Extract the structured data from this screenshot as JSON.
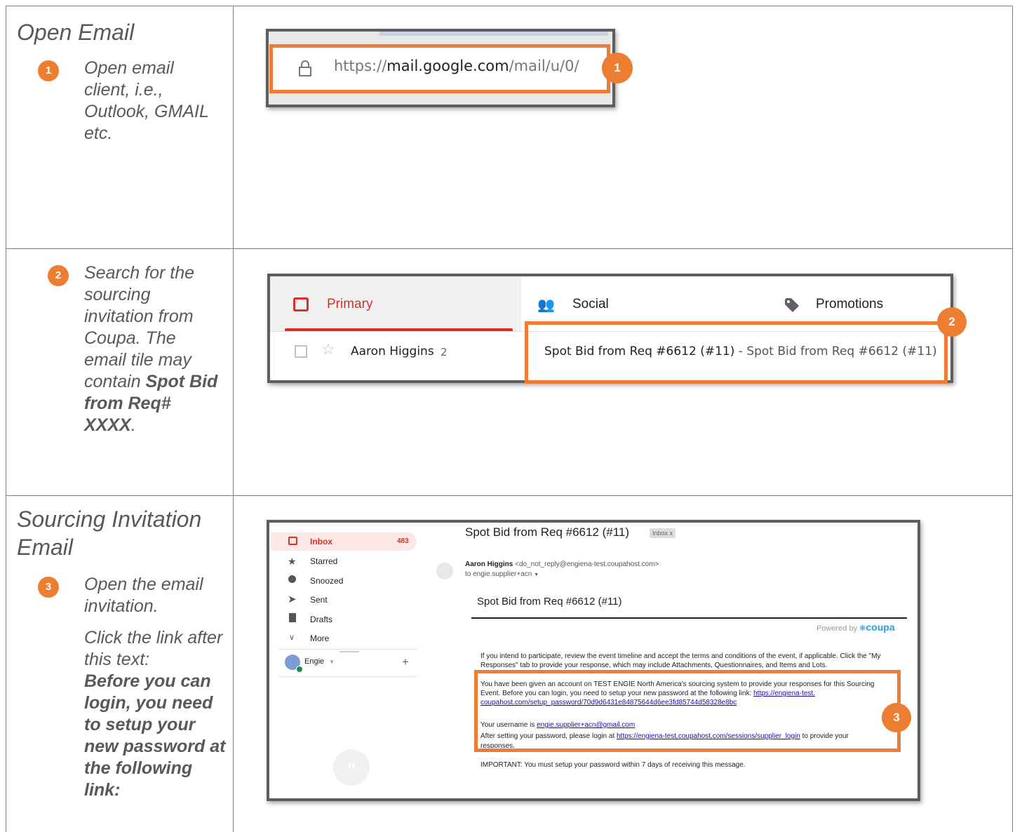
{
  "rows": {
    "row1": {
      "heading": "Open Email",
      "step_number": "1",
      "step_text": "Open email client, i.e., Outlook, GMAIL etc.",
      "shot": {
        "url_scheme": "https://",
        "url_domain": "mail.google.com",
        "url_path": "/mail/u/0/",
        "callout": "1"
      }
    },
    "row2": {
      "step_number": "2",
      "step_text_pre": "Search for the sourcing invitation from Coupa. The email tile may contain ",
      "step_text_bold": "Spot Bid from Req# XXXX",
      "step_text_post": ".",
      "shot": {
        "tab_primary": "Primary",
        "tab_social": "Social",
        "tab_promotions": "Promotions",
        "sender": "Aaron Higgins",
        "sender_count": "2",
        "subject": "Spot Bid from Req #6612 (#11)",
        "separator": " - ",
        "snippet": "Spot Bid from Req #6612 (#11)",
        "callout": "2"
      }
    },
    "row3": {
      "heading": "Sourcing Invitation Email",
      "step_number": "3",
      "step_text": "Open the email invitation.",
      "step_text2": "Click the link after this text:",
      "step_text_bold": "Before you can login, you need to setup your new password at the following link:",
      "shot": {
        "sidebar": {
          "inbox": "Inbox",
          "inbox_count": "483",
          "starred": "Starred",
          "snoozed": "Snoozed",
          "sent": "Sent",
          "drafts": "Drafts",
          "more": "More",
          "account": "Engie"
        },
        "subject": "Spot Bid from Req #6612 (#11)",
        "label_chip": "Inbox",
        "label_chip_close": "x",
        "from_name": "Aaron Higgins",
        "from_email": "<do_not_reply@engiena-test.coupahost.com>",
        "to_line": "to engie.supplier+acn",
        "body_title": "Spot Bid from Req #6612 (#11)",
        "powered_by": "Powered by",
        "brand": "coupa",
        "para1": "If you intend to participate, review the event timeline and accept the terms and conditions of the event, if applicable. Click the \"My Responses\" tab to provide your response, which may include Attachments, Questionnaires, and Items and Lots.",
        "para2_a": "You have been given an account on TEST ENGIE North America's sourcing system to provide your responses for this Sourcing",
        "para2_b": "Event. Before you can login, you need to setup your new password at the following link:",
        "para2_link1": "https://engiena-test.",
        "para2_link2": "coupahost.com/setup_password/70d9d6431e84875644d6ee3fd85744d58328e8bc",
        "username_label": "Your username is",
        "username": "engie.supplier+acn@gmail.com",
        "after_text": "After setting your password, please login at",
        "login_link": "https://engiena-test.coupahost.com/sessions/supplier_login",
        "after_text2": "to provide your",
        "after_text3": "responses.",
        "important": "IMPORTANT: You must setup your password within 7 days of receiving this message.",
        "callout": "3"
      }
    }
  },
  "colors": {
    "accent": "#ED7D31",
    "gmail_red": "#D93025",
    "text_grey": "#595959"
  }
}
